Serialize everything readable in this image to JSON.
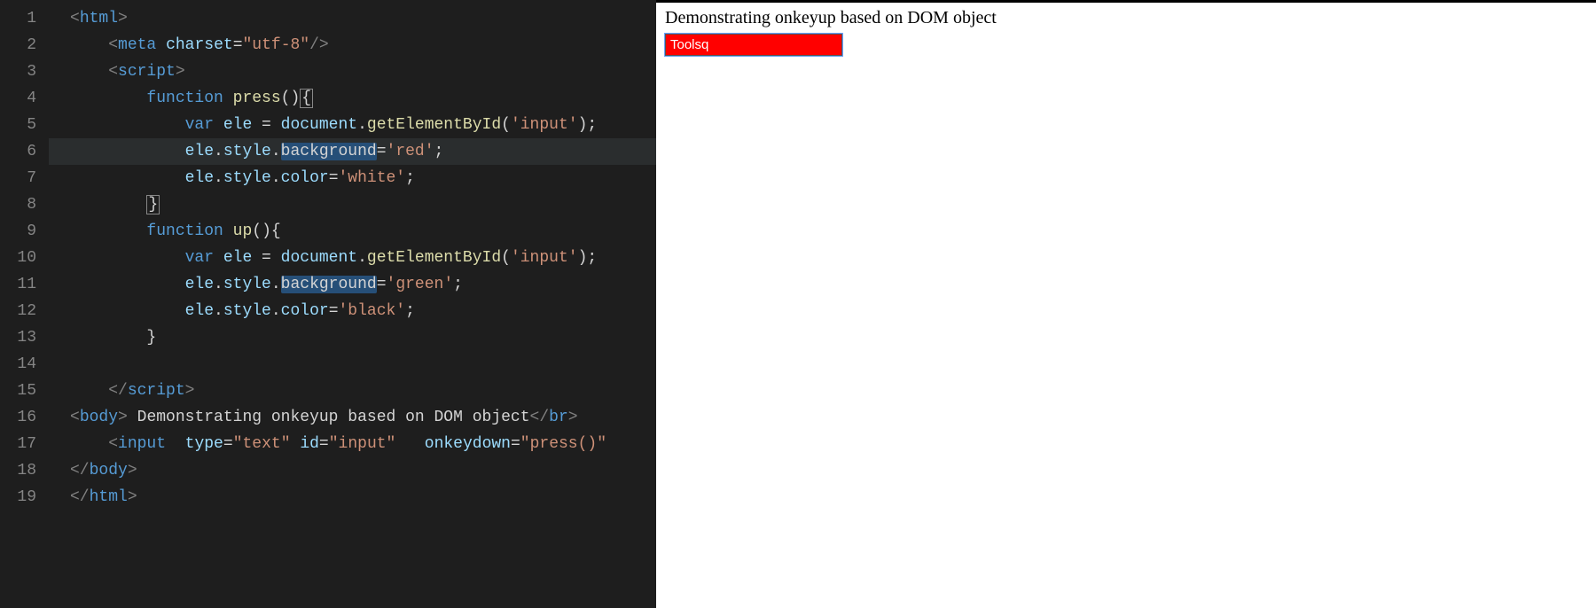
{
  "editor": {
    "lineCount": 19,
    "highlightLine": 6,
    "lines": {
      "l1": [
        [
          "t-angle",
          "<"
        ],
        [
          "t-tag",
          "html"
        ],
        [
          "t-angle",
          ">"
        ]
      ],
      "l2": [
        [
          "",
          "    "
        ],
        [
          "t-angle",
          "<"
        ],
        [
          "t-tag",
          "meta"
        ],
        [
          "",
          " "
        ],
        [
          "t-attr",
          "charset"
        ],
        [
          "",
          "="
        ],
        [
          "t-str",
          "\"utf-8\""
        ],
        [
          "t-angle",
          "/>"
        ]
      ],
      "l3": [
        [
          "",
          "    "
        ],
        [
          "t-angle",
          "<"
        ],
        [
          "t-tag",
          "script"
        ],
        [
          "t-angle",
          ">"
        ]
      ],
      "l4": [
        [
          "",
          "        "
        ],
        [
          "t-kw",
          "function"
        ],
        [
          "",
          " "
        ],
        [
          "t-fn",
          "press"
        ],
        [
          "",
          "()"
        ],
        [
          "bracket-box",
          "{"
        ]
      ],
      "l5": [
        [
          "",
          "            "
        ],
        [
          "t-var",
          "var"
        ],
        [
          "",
          " "
        ],
        [
          "t-id",
          "ele"
        ],
        [
          "",
          " = "
        ],
        [
          "t-id",
          "document"
        ],
        [
          "",
          "."
        ],
        [
          "t-fn",
          "getElementById"
        ],
        [
          "",
          "("
        ],
        [
          "t-str",
          "'input'"
        ],
        [
          "",
          ");"
        ]
      ],
      "l6": [
        [
          "",
          "            "
        ],
        [
          "t-id",
          "ele"
        ],
        [
          "",
          "."
        ],
        [
          "t-id",
          "style"
        ],
        [
          "",
          "."
        ],
        [
          "t-sel",
          "background"
        ],
        [
          "",
          "="
        ],
        [
          "t-str",
          "'red'"
        ],
        [
          "",
          ";"
        ]
      ],
      "l7": [
        [
          "",
          "            "
        ],
        [
          "t-id",
          "ele"
        ],
        [
          "",
          "."
        ],
        [
          "t-id",
          "style"
        ],
        [
          "",
          "."
        ],
        [
          "t-id",
          "color"
        ],
        [
          "",
          "="
        ],
        [
          "t-str",
          "'white'"
        ],
        [
          "",
          ";"
        ]
      ],
      "l8": [
        [
          "",
          "        "
        ],
        [
          "bracket-box",
          "}"
        ]
      ],
      "l9": [
        [
          "",
          "        "
        ],
        [
          "t-kw",
          "function"
        ],
        [
          "",
          " "
        ],
        [
          "t-fn",
          "up"
        ],
        [
          "",
          "(){"
        ]
      ],
      "l10": [
        [
          "",
          "            "
        ],
        [
          "t-var",
          "var"
        ],
        [
          "",
          " "
        ],
        [
          "t-id",
          "ele"
        ],
        [
          "",
          " = "
        ],
        [
          "t-id",
          "document"
        ],
        [
          "",
          "."
        ],
        [
          "t-fn",
          "getElementById"
        ],
        [
          "",
          "("
        ],
        [
          "t-str",
          "'input'"
        ],
        [
          "",
          ");"
        ]
      ],
      "l11": [
        [
          "",
          "            "
        ],
        [
          "t-id",
          "ele"
        ],
        [
          "",
          "."
        ],
        [
          "t-id",
          "style"
        ],
        [
          "",
          "."
        ],
        [
          "t-sel",
          "background"
        ],
        [
          "",
          "="
        ],
        [
          "t-str",
          "'green'"
        ],
        [
          "",
          ";"
        ]
      ],
      "l12": [
        [
          "",
          "            "
        ],
        [
          "t-id",
          "ele"
        ],
        [
          "",
          "."
        ],
        [
          "t-id",
          "style"
        ],
        [
          "",
          "."
        ],
        [
          "t-id",
          "color"
        ],
        [
          "",
          "="
        ],
        [
          "t-str",
          "'black'"
        ],
        [
          "",
          ";"
        ]
      ],
      "l13": [
        [
          "",
          "        }"
        ]
      ],
      "l14": [
        [
          "",
          ""
        ]
      ],
      "l15": [
        [
          "",
          "    "
        ],
        [
          "t-angle",
          "</"
        ],
        [
          "t-tag",
          "script"
        ],
        [
          "t-angle",
          ">"
        ]
      ],
      "l16": [
        [
          "t-angle",
          "<"
        ],
        [
          "t-tag",
          "body"
        ],
        [
          "t-angle",
          ">"
        ],
        [
          "",
          " Demonstrating onkeyup based on DOM object"
        ],
        [
          "t-angle",
          "</"
        ],
        [
          "t-tag",
          "br"
        ],
        [
          "t-angle",
          ">"
        ]
      ],
      "l17": [
        [
          "",
          "    "
        ],
        [
          "t-angle",
          "<"
        ],
        [
          "t-tag",
          "input"
        ],
        [
          "",
          "  "
        ],
        [
          "t-attr",
          "type"
        ],
        [
          "",
          "="
        ],
        [
          "t-str",
          "\"text\""
        ],
        [
          "",
          " "
        ],
        [
          "t-attr",
          "id"
        ],
        [
          "",
          "="
        ],
        [
          "t-str",
          "\"input\""
        ],
        [
          "",
          "   "
        ],
        [
          "t-attr",
          "onkeydown"
        ],
        [
          "",
          "="
        ],
        [
          "t-str",
          "\"press()\""
        ]
      ],
      "l18": [
        [
          "t-angle",
          "</"
        ],
        [
          "t-tag",
          "body"
        ],
        [
          "t-angle",
          ">"
        ]
      ],
      "l19": [
        [
          "t-angle",
          "</"
        ],
        [
          "t-tag",
          "html"
        ],
        [
          "t-angle",
          ">"
        ]
      ]
    }
  },
  "preview": {
    "headingText": "Demonstrating onkeyup based on DOM object",
    "inputValue": "Toolsq",
    "inputBackground": "#ff0000",
    "inputColor": "#ffffff"
  }
}
